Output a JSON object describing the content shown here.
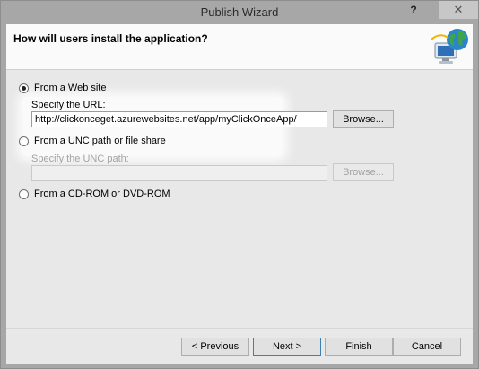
{
  "window": {
    "title": "Publish Wizard",
    "help_glyph": "?",
    "close_glyph": "✕"
  },
  "header": {
    "title": "How will users install the application?",
    "icon": "globe-computer-icon"
  },
  "options": {
    "web": {
      "label": "From a Web site",
      "selected": true,
      "url_label": "Specify the URL:",
      "url_value": "http://clickonceget.azurewebsites.net/app/myClickOnceApp/",
      "browse_label": "Browse..."
    },
    "unc": {
      "label": "From a UNC path or file share",
      "selected": false,
      "path_label": "Specify the UNC path:",
      "path_value": "",
      "browse_label": "Browse..."
    },
    "cd": {
      "label": "From a CD-ROM or DVD-ROM",
      "selected": false
    }
  },
  "buttons": {
    "previous": "< Previous",
    "next": "Next >",
    "finish": "Finish",
    "cancel": "Cancel"
  }
}
